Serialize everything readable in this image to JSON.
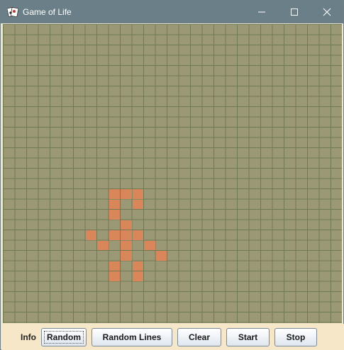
{
  "window": {
    "title": "Game of Life",
    "app_icon": "cards-icon"
  },
  "window_controls": {
    "minimize": "minimize-icon",
    "maximize": "maximize-icon",
    "close": "close-icon"
  },
  "board": {
    "columns": 29,
    "rows": 29,
    "background_color": "#9b9975",
    "grid_color": "#6f7a55",
    "live_cell_color": "#d9875a",
    "live_cells": [
      [
        9,
        16
      ],
      [
        10,
        16
      ],
      [
        11,
        16
      ],
      [
        9,
        17
      ],
      [
        11,
        17
      ],
      [
        9,
        18
      ],
      [
        10,
        19
      ],
      [
        7,
        20
      ],
      [
        9,
        20
      ],
      [
        10,
        20
      ],
      [
        11,
        20
      ],
      [
        8,
        21
      ],
      [
        10,
        21
      ],
      [
        12,
        21
      ],
      [
        10,
        22
      ],
      [
        13,
        22
      ],
      [
        9,
        23
      ],
      [
        11,
        23
      ],
      [
        9,
        24
      ],
      [
        11,
        24
      ]
    ]
  },
  "controls": {
    "info_label": "Info",
    "random_label": "Random",
    "random_lines_label": "Random Lines",
    "clear_label": "Clear",
    "start_label": "Start",
    "stop_label": "Stop"
  }
}
